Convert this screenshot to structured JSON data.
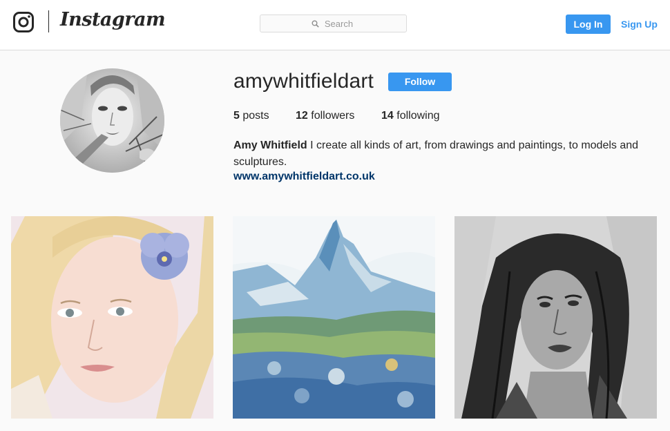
{
  "header": {
    "logo_text": "Instagram",
    "search_placeholder": "Search",
    "login_label": "Log In",
    "signup_label": "Sign Up",
    "brand_color": "#3897f0"
  },
  "profile": {
    "username": "amywhitfieldart",
    "follow_label": "Follow",
    "stats": {
      "posts_count": "5",
      "posts_label": "posts",
      "followers_count": "12",
      "followers_label": "followers",
      "following_count": "14",
      "following_label": "following"
    },
    "full_name": "Amy Whitfield",
    "bio": "I create all kinds of art, from drawings and paintings, to models and sculptures.",
    "website": "www.amywhitfieldart.co.uk"
  },
  "posts": [
    {
      "subject": "pencil portrait of blonde girl with blue pansy in hair"
    },
    {
      "subject": "watercolor mountain landscape with blue flowers"
    },
    {
      "subject": "graphite portrait of woman with long dark hair"
    }
  ],
  "icons": {
    "camera": "instagram-camera-icon",
    "search": "search-icon"
  }
}
